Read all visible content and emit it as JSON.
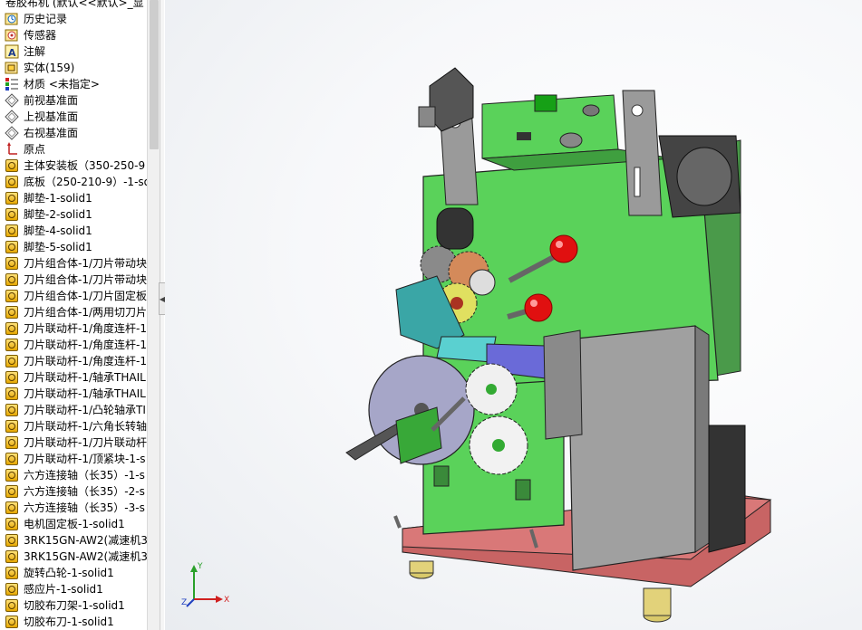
{
  "tree": {
    "title": "卷胶布机 (默认<<默认>_显",
    "items": [
      {
        "label": "历史记录",
        "icon": "history-icon"
      },
      {
        "label": "传感器",
        "icon": "sensor-icon"
      },
      {
        "label": "注解",
        "icon": "annotation-icon"
      },
      {
        "label": "实体(159)",
        "icon": "solid-bodies-icon"
      },
      {
        "label": "材质 <未指定>",
        "icon": "material-icon"
      },
      {
        "label": "前视基准面",
        "icon": "plane-icon"
      },
      {
        "label": "上视基准面",
        "icon": "plane-icon"
      },
      {
        "label": "右视基准面",
        "icon": "plane-icon"
      },
      {
        "label": "原点",
        "icon": "origin-icon"
      },
      {
        "label": "主体安装板（350-250-9",
        "icon": "part-icon"
      },
      {
        "label": "底板（250-210-9）-1-so",
        "icon": "part-icon"
      },
      {
        "label": "脚垫-1-solid1",
        "icon": "part-icon"
      },
      {
        "label": "脚垫-2-solid1",
        "icon": "part-icon"
      },
      {
        "label": "脚垫-4-solid1",
        "icon": "part-icon"
      },
      {
        "label": "脚垫-5-solid1",
        "icon": "part-icon"
      },
      {
        "label": "刀片组合体-1/刀片带动块",
        "icon": "part-icon"
      },
      {
        "label": "刀片组合体-1/刀片带动块",
        "icon": "part-icon"
      },
      {
        "label": "刀片组合体-1/刀片固定板",
        "icon": "part-icon"
      },
      {
        "label": "刀片组合体-1/两用切刀片",
        "icon": "part-icon"
      },
      {
        "label": "刀片联动杆-1/角度连杆-1",
        "icon": "part-icon"
      },
      {
        "label": "刀片联动杆-1/角度连杆-1",
        "icon": "part-icon"
      },
      {
        "label": "刀片联动杆-1/角度连杆-1",
        "icon": "part-icon"
      },
      {
        "label": "刀片联动杆-1/轴承THAIL",
        "icon": "part-icon"
      },
      {
        "label": "刀片联动杆-1/轴承THAIL",
        "icon": "part-icon"
      },
      {
        "label": "刀片联动杆-1/凸轮轴承TI",
        "icon": "part-icon"
      },
      {
        "label": "刀片联动杆-1/六角长转轴",
        "icon": "part-icon"
      },
      {
        "label": "刀片联动杆-1/刀片联动杆",
        "icon": "part-icon"
      },
      {
        "label": "刀片联动杆-1/顶紧块-1-s",
        "icon": "part-icon"
      },
      {
        "label": "六方连接轴（长35）-1-s",
        "icon": "part-icon"
      },
      {
        "label": "六方连接轴（长35）-2-s",
        "icon": "part-icon"
      },
      {
        "label": "六方连接轴（长35）-3-s",
        "icon": "part-icon"
      },
      {
        "label": "电机固定板-1-solid1",
        "icon": "part-icon"
      },
      {
        "label": "3RK15GN-AW2(减速机3",
        "icon": "part-icon"
      },
      {
        "label": "3RK15GN-AW2(减速机3",
        "icon": "part-icon"
      },
      {
        "label": "旋转凸轮-1-solid1",
        "icon": "part-icon"
      },
      {
        "label": "感应片-1-solid1",
        "icon": "part-icon"
      },
      {
        "label": "切胶布刀架-1-solid1",
        "icon": "part-icon"
      },
      {
        "label": "切胶布刀-1-solid1",
        "icon": "part-icon"
      }
    ]
  },
  "triad": {
    "x": "X",
    "y": "Y",
    "z": "Z"
  },
  "colors": {
    "plate_green": "#5ad25a",
    "base_red": "#c86464",
    "gray_metal": "#9a9a9a",
    "knob_red": "#e01010"
  }
}
